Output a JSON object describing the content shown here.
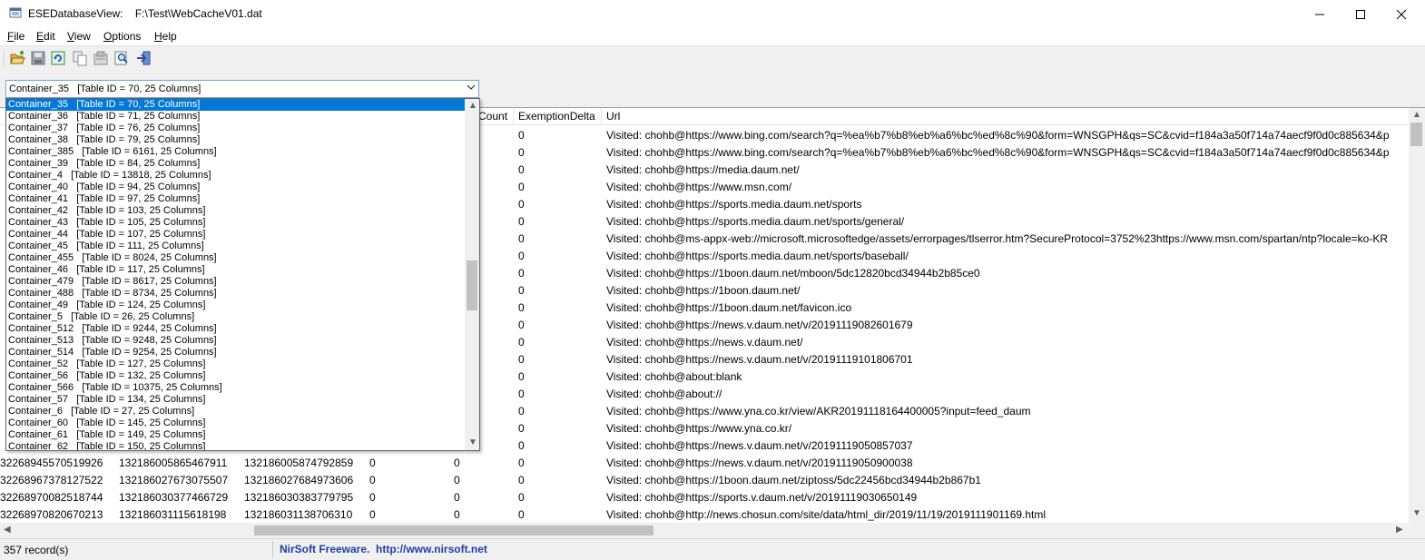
{
  "window": {
    "title": "ESEDatabaseView:    F:\\Test\\WebCacheV01.dat",
    "icons": [
      "app-icon",
      "minimize-icon",
      "maximize-icon",
      "close-icon"
    ]
  },
  "menu": {
    "file_u": "F",
    "file_r": "ile",
    "edit_u": "E",
    "edit_r": "dit",
    "view_u": "V",
    "view_r": "iew",
    "options_u": "O",
    "options_r": "ptions",
    "help_u": "H",
    "help_r": "elp"
  },
  "toolbar": {
    "icons": [
      "open-icon",
      "save-icon",
      "refresh-icon",
      "copy-icon",
      "properties-icon",
      "find-icon",
      "exit-icon"
    ]
  },
  "table_selector": {
    "selected": "Container_35   [Table ID = 70, 25 Columns]",
    "options": [
      "Container_35   [Table ID = 70, 25 Columns]",
      "Container_36   [Table ID = 71, 25 Columns]",
      "Container_37   [Table ID = 76, 25 Columns]",
      "Container_38   [Table ID = 79, 25 Columns]",
      "Container_385   [Table ID = 6161, 25 Columns]",
      "Container_39   [Table ID = 84, 25 Columns]",
      "Container_4   [Table ID = 13818, 25 Columns]",
      "Container_40   [Table ID = 94, 25 Columns]",
      "Container_41   [Table ID = 97, 25 Columns]",
      "Container_42   [Table ID = 103, 25 Columns]",
      "Container_43   [Table ID = 105, 25 Columns]",
      "Container_44   [Table ID = 107, 25 Columns]",
      "Container_45   [Table ID = 111, 25 Columns]",
      "Container_455   [Table ID = 8024, 25 Columns]",
      "Container_46   [Table ID = 117, 25 Columns]",
      "Container_479   [Table ID = 8617, 25 Columns]",
      "Container_488   [Table ID = 8734, 25 Columns]",
      "Container_49   [Table ID = 124, 25 Columns]",
      "Container_5   [Table ID = 26, 25 Columns]",
      "Container_512   [Table ID = 9244, 25 Columns]",
      "Container_513   [Table ID = 9248, 25 Columns]",
      "Container_514   [Table ID = 9254, 25 Columns]",
      "Container_52   [Table ID = 127, 25 Columns]",
      "Container_56   [Table ID = 132, 25 Columns]",
      "Container_566   [Table ID = 10375, 25 Columns]",
      "Container_57   [Table ID = 134, 25 Columns]",
      "Container_6   [Table ID = 27, 25 Columns]",
      "Container_60   [Table ID = 145, 25 Columns]",
      "Container_61   [Table ID = 149, 25 Columns]",
      "Container_62   [Table ID = 150, 25 Columns]"
    ]
  },
  "grid": {
    "headers": {
      "count": "Count",
      "exemption": "ExemptionDelta",
      "url": "Url"
    },
    "rows": [
      {
        "c1": "",
        "c2": "",
        "c3": "",
        "c4": "",
        "c5": "",
        "ex": "0",
        "url": "Visited: chohb@https://www.bing.com/search?q=%ea%b7%b8%eb%a6%bc%ed%8c%90&form=WNSGPH&qs=SC&cvid=f184a3a50f714a74aecf9f0d0c885634&p"
      },
      {
        "c1": "",
        "c2": "",
        "c3": "",
        "c4": "",
        "c5": "",
        "ex": "0",
        "url": "Visited: chohb@https://www.bing.com/search?q=%ea%b7%b8%eb%a6%bc%ed%8c%90&form=WNSGPH&qs=SC&cvid=f184a3a50f714a74aecf9f0d0c885634&p"
      },
      {
        "c1": "",
        "c2": "",
        "c3": "",
        "c4": "",
        "c5": "",
        "ex": "0",
        "url": "Visited: chohb@https://media.daum.net/"
      },
      {
        "c1": "",
        "c2": "",
        "c3": "",
        "c4": "",
        "c5": "",
        "ex": "0",
        "url": "Visited: chohb@https://www.msn.com/"
      },
      {
        "c1": "",
        "c2": "",
        "c3": "",
        "c4": "",
        "c5": "",
        "ex": "0",
        "url": "Visited: chohb@https://sports.media.daum.net/sports"
      },
      {
        "c1": "",
        "c2": "",
        "c3": "",
        "c4": "",
        "c5": "",
        "ex": "0",
        "url": "Visited: chohb@https://sports.media.daum.net/sports/general/"
      },
      {
        "c1": "",
        "c2": "",
        "c3": "",
        "c4": "",
        "c5": "",
        "ex": "0",
        "url": "Visited: chohb@ms-appx-web://microsoft.microsoftedge/assets/errorpages/tlserror.htm?SecureProtocol=3752%23https://www.msn.com/spartan/ntp?locale=ko-KR"
      },
      {
        "c1": "",
        "c2": "",
        "c3": "",
        "c4": "",
        "c5": "",
        "ex": "0",
        "url": "Visited: chohb@https://sports.media.daum.net/sports/baseball/"
      },
      {
        "c1": "",
        "c2": "",
        "c3": "",
        "c4": "",
        "c5": "",
        "ex": "0",
        "url": "Visited: chohb@https://1boon.daum.net/mboon/5dc12820bcd34944b2b85ce0"
      },
      {
        "c1": "",
        "c2": "",
        "c3": "",
        "c4": "",
        "c5": "",
        "ex": "0",
        "url": "Visited: chohb@https://1boon.daum.net/"
      },
      {
        "c1": "",
        "c2": "",
        "c3": "",
        "c4": "",
        "c5": "",
        "ex": "0",
        "url": "Visited: chohb@https://1boon.daum.net/favicon.ico"
      },
      {
        "c1": "",
        "c2": "",
        "c3": "",
        "c4": "",
        "c5": "",
        "ex": "0",
        "url": "Visited: chohb@https://news.v.daum.net/v/20191119082601679"
      },
      {
        "c1": "",
        "c2": "",
        "c3": "",
        "c4": "",
        "c5": "",
        "ex": "0",
        "url": "Visited: chohb@https://news.v.daum.net/"
      },
      {
        "c1": "",
        "c2": "",
        "c3": "",
        "c4": "",
        "c5": "",
        "ex": "0",
        "url": "Visited: chohb@https://news.v.daum.net/v/20191119101806701"
      },
      {
        "c1": "",
        "c2": "",
        "c3": "",
        "c4": "",
        "c5": "",
        "ex": "0",
        "url": "Visited: chohb@about:blank"
      },
      {
        "c1": "",
        "c2": "",
        "c3": "",
        "c4": "",
        "c5": "",
        "ex": "0",
        "url": "Visited: chohb@about://"
      },
      {
        "c1": "",
        "c2": "",
        "c3": "",
        "c4": "",
        "c5": "",
        "ex": "0",
        "url": "Visited: chohb@https://www.yna.co.kr/view/AKR20191118164400005?input=feed_daum"
      },
      {
        "c1": "",
        "c2": "",
        "c3": "",
        "c4": "",
        "c5": "",
        "ex": "0",
        "url": "Visited: chohb@https://www.yna.co.kr/"
      },
      {
        "c1": "",
        "c2": "",
        "c3": "",
        "c4": "",
        "c5": "",
        "ex": "0",
        "url": "Visited: chohb@https://news.v.daum.net/v/20191119050857037"
      },
      {
        "c1": "32268945570519926",
        "c2": "132186005865467911",
        "c3": "132186005874792859",
        "c4": "0",
        "c5": "0",
        "ex": "0",
        "url": "Visited: chohb@https://news.v.daum.net/v/20191119050900038"
      },
      {
        "c1": "32268967378127522",
        "c2": "132186027673075507",
        "c3": "132186027684973606",
        "c4": "0",
        "c5": "0",
        "ex": "0",
        "url": "Visited: chohb@https://1boon.daum.net/ziptoss/5dc22456bcd34944b2b867b1"
      },
      {
        "c1": "32268970082518744",
        "c2": "132186030377466729",
        "c3": "132186030383779795",
        "c4": "0",
        "c5": "0",
        "ex": "0",
        "url": "Visited: chohb@https://sports.v.daum.net/v/20191119030650149"
      },
      {
        "c1": "32268970820670213",
        "c2": "132186031115618198",
        "c3": "132186031138706310",
        "c4": "0",
        "c5": "0",
        "ex": "0",
        "url": "Visited: chohb@http://news.chosun.com/site/data/html_dir/2019/11/19/2019111901169.html"
      }
    ]
  },
  "status": {
    "records": "357 record(s)",
    "link": "NirSoft Freeware.  http://www.nirsoft.net"
  }
}
